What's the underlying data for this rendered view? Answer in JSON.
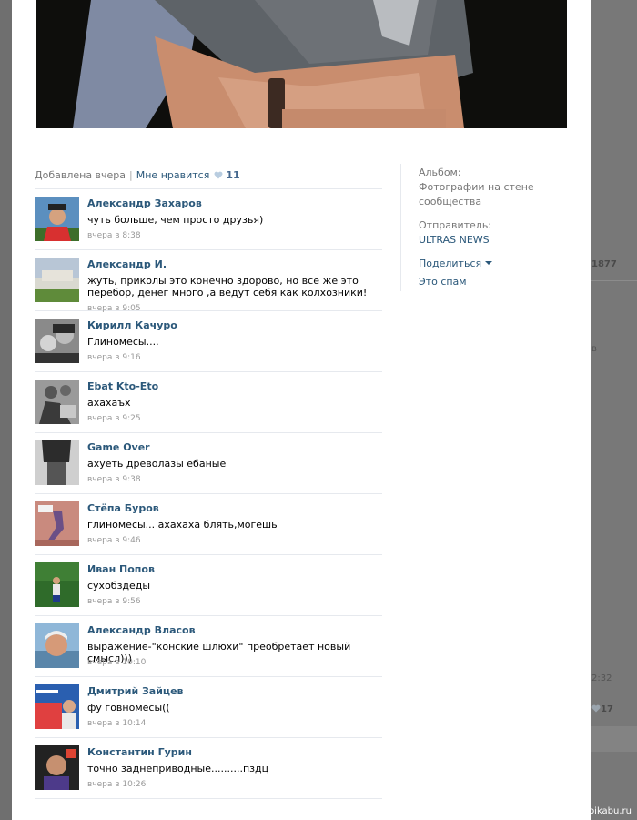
{
  "post": {
    "added": "Добавлена вчера",
    "like_label": "Мне нравится",
    "like_count": "11"
  },
  "sidebar": {
    "album_label": "Альбом:",
    "album_value": "Фотографии на стене сообщества",
    "sender_label": "Отправитель:",
    "sender_value": "ULTRAS NEWS",
    "share": "Поделиться",
    "spam": "Это спам"
  },
  "comments": [
    {
      "author": "Александр Захаров",
      "text": "чуть больше, чем просто друзья)",
      "date": "вчера в 8:38"
    },
    {
      "author": "Александр И.",
      "text": "жуть, приколы это конечно здорово, но все же это перебор, денег много ,а ведут себя как колхозники!",
      "date": "вчера в 9:05"
    },
    {
      "author": "Кирилл Качуро",
      "text": "Глиномесы....",
      "date": "вчера в 9:16"
    },
    {
      "author": "Ebat Kto-Eto",
      "text": "ахахаъх",
      "date": "вчера в 9:25"
    },
    {
      "author": "Game Over",
      "text": "ахуеть древолазы ебаные",
      "date": "вчера в 9:38"
    },
    {
      "author": "Стёпа Буров",
      "text": "глиномесы... ахахаха блять,могёшь",
      "date": "вчера в 9:46"
    },
    {
      "author": "Иван Попов",
      "text": "сухобздеды",
      "date": "вчера в 9:56"
    },
    {
      "author": "Александр Власов",
      "text": "выражение-\"конские шлюхи\" преобретает новый смысл)))",
      "date": "вчера в 10:10"
    },
    {
      "author": "Дмитрий Зайцев",
      "text": "фу говномесы((",
      "date": "вчера в 10:14"
    },
    {
      "author": "Константин Гурин",
      "text": "точно заднеприводные..........пздц",
      "date": "вчера в 10:26"
    }
  ],
  "background": {
    "count_a": "1877",
    "letter_b": "в",
    "time": "2:32",
    "likes_b": "17"
  },
  "watermark": "pikabu.ru"
}
